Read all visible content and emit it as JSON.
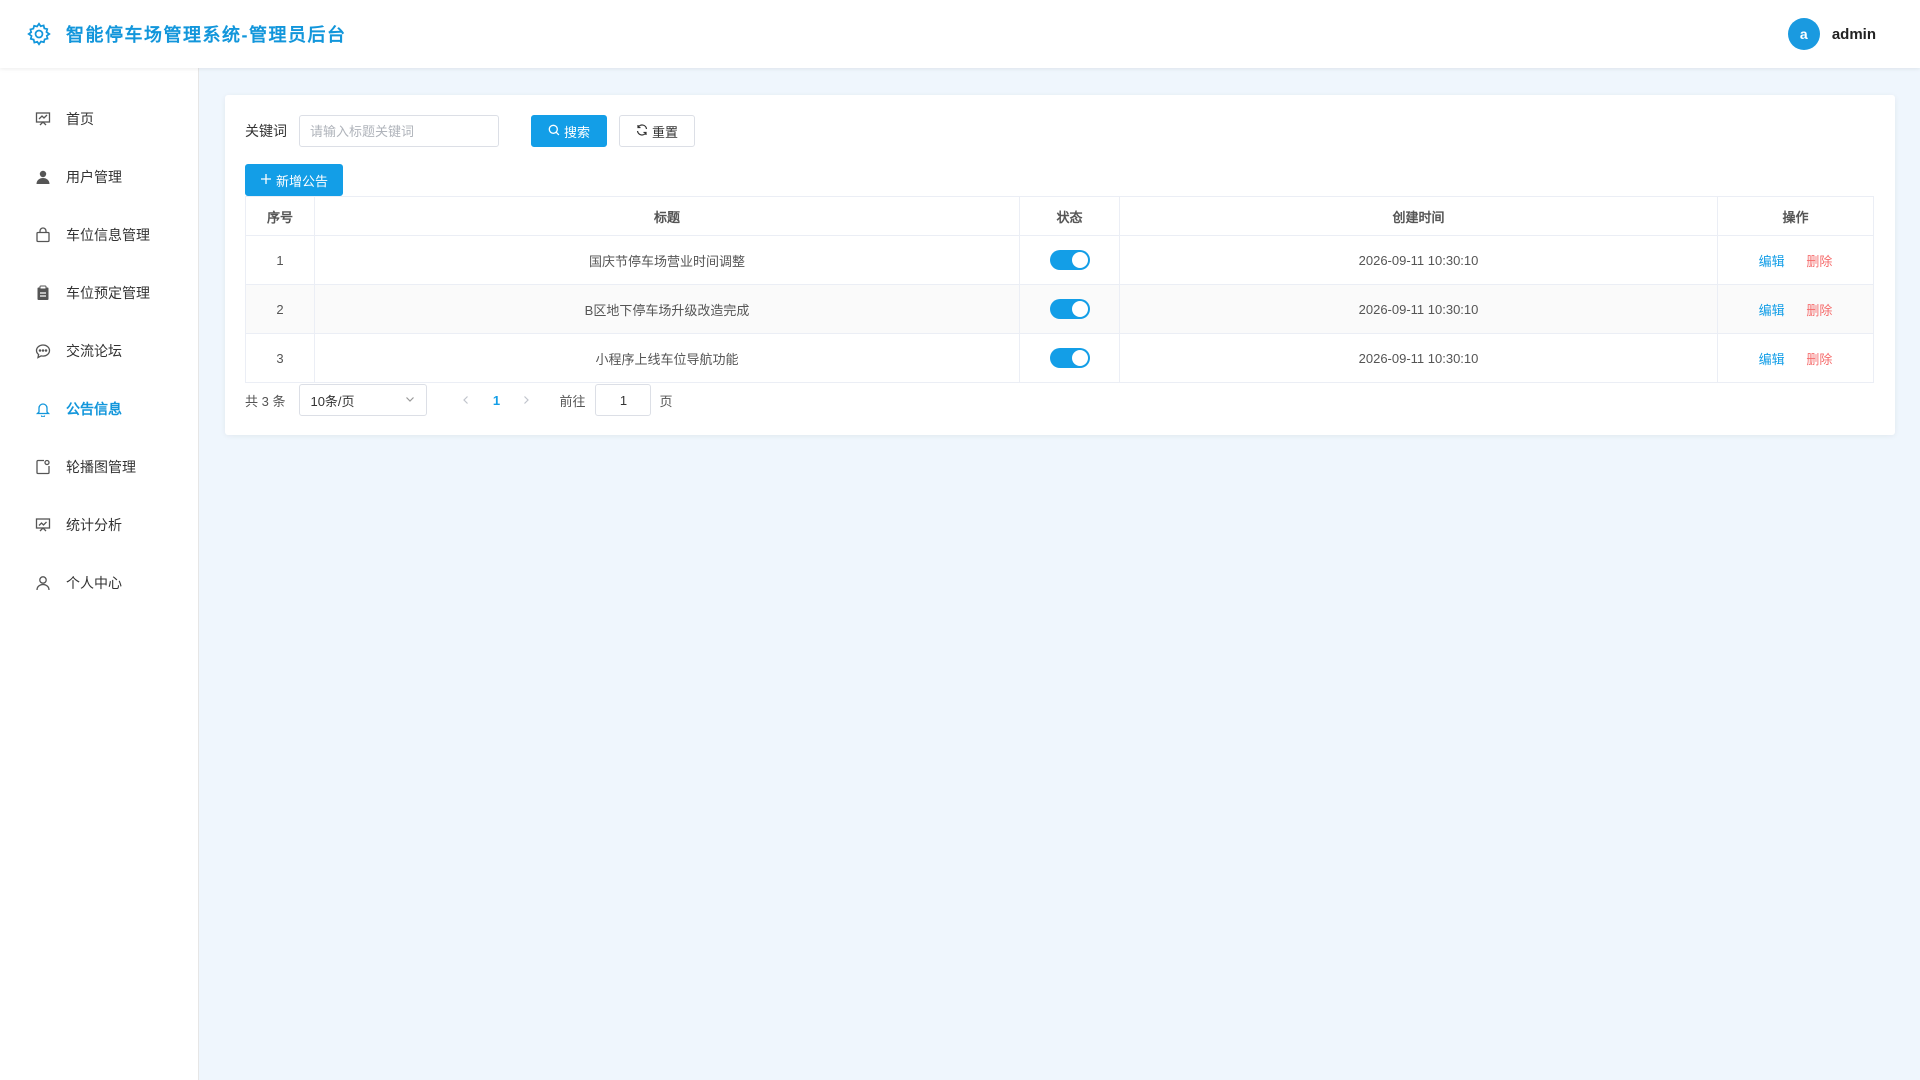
{
  "header": {
    "title": "智能停车场管理系统-管理员后台",
    "avatar_letter": "a",
    "username": "admin",
    "accent_color": "#1296db"
  },
  "sidebar": {
    "items": [
      {
        "label": "首页",
        "icon": "dashboard-icon",
        "active": false
      },
      {
        "label": "用户管理",
        "icon": "user-icon",
        "active": false
      },
      {
        "label": "车位信息管理",
        "icon": "shopping-bag-icon",
        "active": false
      },
      {
        "label": "车位预定管理",
        "icon": "clipboard-icon",
        "active": false
      },
      {
        "label": "交流论坛",
        "icon": "chat-icon",
        "active": false
      },
      {
        "label": "公告信息",
        "icon": "bell-icon",
        "active": true
      },
      {
        "label": "轮播图管理",
        "icon": "carousel-icon",
        "active": false
      },
      {
        "label": "统计分析",
        "icon": "chart-icon",
        "active": false
      },
      {
        "label": "个人中心",
        "icon": "person-icon",
        "active": false
      }
    ]
  },
  "filter": {
    "keyword_label": "关键词",
    "keyword_placeholder": "请输入标题关键词",
    "keyword_value": "",
    "search_label": "搜索",
    "reset_label": "重置"
  },
  "add_button": "新增公告",
  "table": {
    "columns": [
      "序号",
      "标题",
      "状态",
      "创建时间",
      "操作"
    ],
    "rows": [
      {
        "index": "1",
        "title": "国庆节停车场营业时间调整",
        "status": true,
        "created": "2026-09-11 10:30:10"
      },
      {
        "index": "2",
        "title": "B区地下停车场升级改造完成",
        "status": true,
        "created": "2026-09-11 10:30:10"
      },
      {
        "index": "3",
        "title": "小程序上线车位导航功能",
        "status": true,
        "created": "2026-09-11 10:30:10"
      }
    ],
    "edit_label": "编辑",
    "delete_label": "删除"
  },
  "pagination": {
    "total_text": "共 3 条",
    "page_size": "10条/页",
    "current_page": "1",
    "goto_label": "前往",
    "goto_value": "1",
    "page_suffix": "页"
  }
}
